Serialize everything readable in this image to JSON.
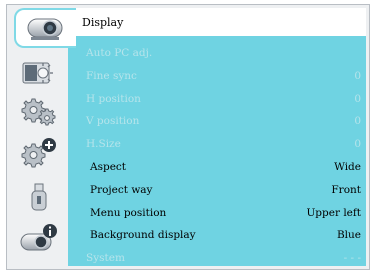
{
  "menu": {
    "title": "Display",
    "items": [
      {
        "label": "Auto PC adj.",
        "value": "",
        "enabled": false
      },
      {
        "label": "Fine sync",
        "value": "0",
        "enabled": false
      },
      {
        "label": "H position",
        "value": "0",
        "enabled": false
      },
      {
        "label": "V position",
        "value": "0",
        "enabled": false
      },
      {
        "label": "H.Size",
        "value": "0",
        "enabled": false
      },
      {
        "label": "Aspect",
        "value": "Wide",
        "enabled": true
      },
      {
        "label": "Project way",
        "value": "Front",
        "enabled": true
      },
      {
        "label": "Menu position",
        "value": "Upper left",
        "enabled": true
      },
      {
        "label": "Background display",
        "value": "Blue",
        "enabled": true
      },
      {
        "label": "System",
        "value": "- - -",
        "enabled": false
      }
    ]
  },
  "sidebar": {
    "items": [
      {
        "icon": "projector-icon",
        "active": true
      },
      {
        "icon": "brightness-adjust-icon",
        "active": false
      },
      {
        "icon": "gear-icon",
        "active": false
      },
      {
        "icon": "gear-plus-icon",
        "active": false
      },
      {
        "icon": "usb-drive-icon",
        "active": false
      },
      {
        "icon": "projector-info-icon",
        "active": false
      }
    ]
  },
  "colors": {
    "accent": "#6fd3e2",
    "disabled_text": "#b6e4eb",
    "enabled_text": "#000000",
    "panel_background": "#eef0f2"
  }
}
